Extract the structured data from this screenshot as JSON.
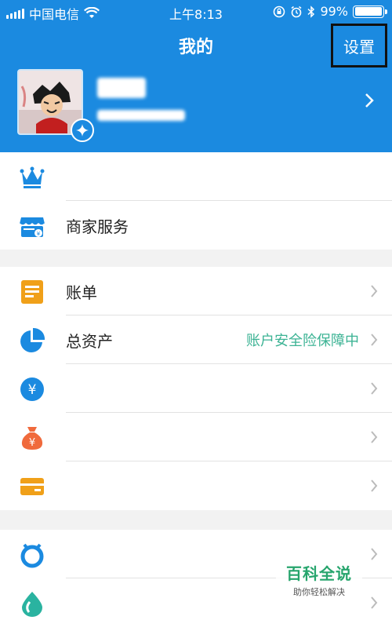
{
  "status_bar": {
    "carrier": "中国电信",
    "time": "上午8:13",
    "battery": "99%",
    "battery_level": 0.99
  },
  "header": {
    "title": "我的",
    "settings_label": "设置",
    "background_color": "#1b8ae0"
  },
  "profile": {
    "avatar_icon": "profile-avatar-image",
    "badge_icon": "sparkle-star-icon",
    "name": "",
    "account": ""
  },
  "section1": {
    "items": [
      {
        "icon": "crown-icon",
        "label": ""
      },
      {
        "icon": "store-icon",
        "label": "商家服务"
      }
    ]
  },
  "section2": {
    "items": [
      {
        "icon": "bill-icon",
        "label": "账单",
        "extra": ""
      },
      {
        "icon": "pie-chart-icon",
        "label": "总资产",
        "extra": "账户安全险保障中"
      },
      {
        "icon": "yen-circle-icon",
        "label": "",
        "extra": ""
      },
      {
        "icon": "money-bag-icon",
        "label": "",
        "extra": ""
      },
      {
        "icon": "card-icon",
        "label": "",
        "extra": ""
      }
    ]
  },
  "section3": {
    "items": [
      {
        "icon": "timer-ring-icon",
        "label": ""
      },
      {
        "icon": "drop-icon",
        "label": ""
      }
    ]
  },
  "watermark": {
    "title": "百科全说",
    "subtitle": "助你轻松解决"
  },
  "colors": {
    "accent_blue": "#1b8ae0",
    "green_text": "#3cb394",
    "orange": "#f0a019",
    "red_orange": "#f06a3c"
  }
}
